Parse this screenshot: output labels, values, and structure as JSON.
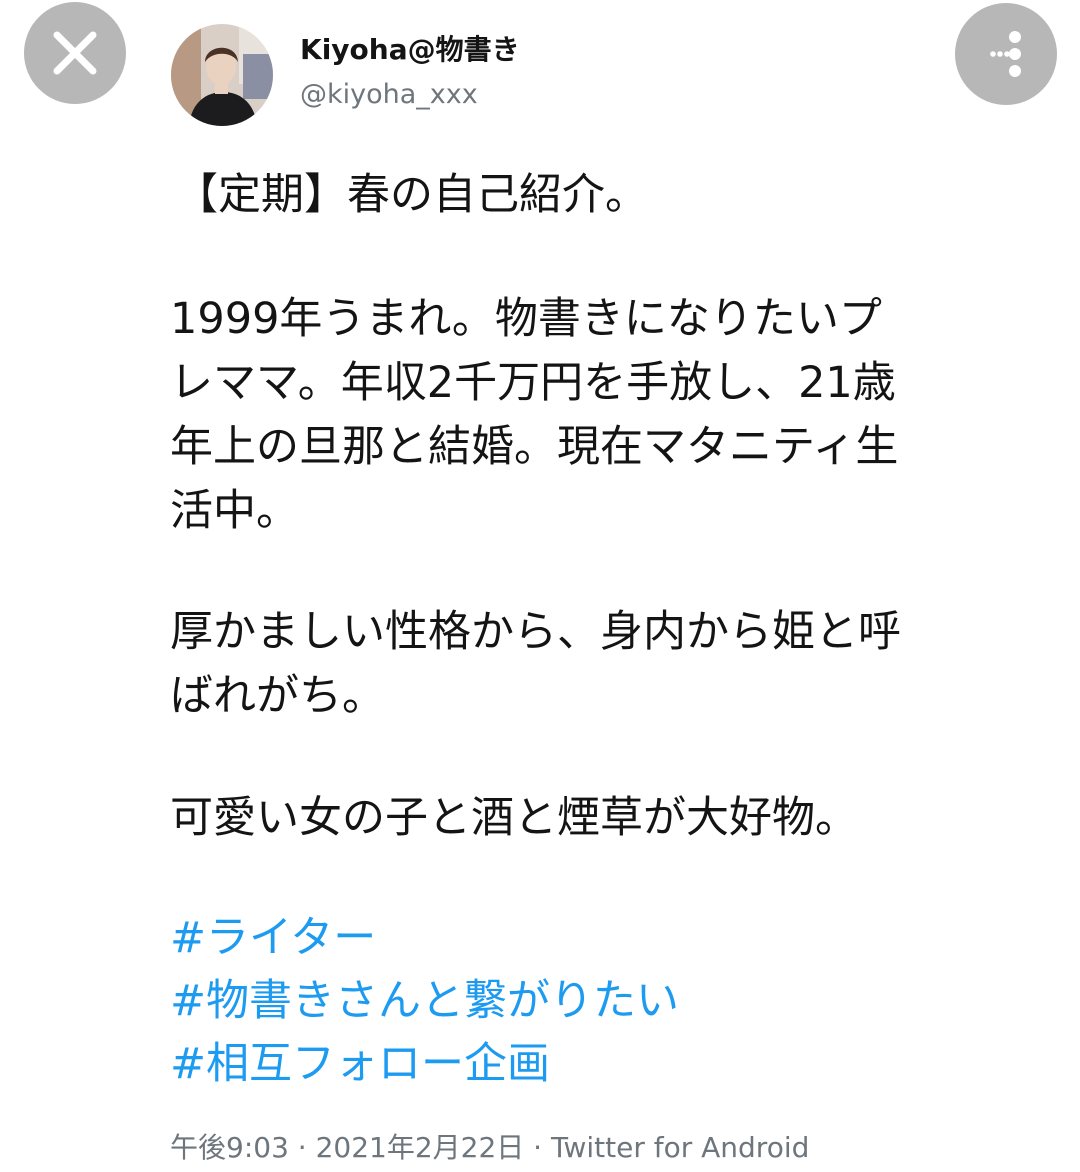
{
  "header": {
    "close_icon": "close-icon",
    "more_icon": "more-options-icon",
    "display_name": "Kiyoha@物書き",
    "handle": "@kiyoha_xxx",
    "colors": {
      "button_bg": "#b7b7b7",
      "text": "#141414",
      "secondary_text": "#6e767d",
      "link": "#1d9bf0"
    }
  },
  "tweet": {
    "lines": [
      "【定期】春の自己紹介。",
      "1999年うまれ。物書きになりたいプ",
      "レママ。年収2千万円を手放し、21歳",
      "年上の旦那と結婚。現在マタニティ生",
      "活中。",
      "厚かましい性格から、身内から姫と呼",
      "ばれがち。",
      "可愛い女の子と酒と煙草が大好物。"
    ],
    "hashtags": [
      "#ライター",
      "#物書きさんと繋がりたい",
      "#相互フォロー企画"
    ],
    "meta": "午後9:03 · 2021年2月22日 · Twitter for Android"
  }
}
